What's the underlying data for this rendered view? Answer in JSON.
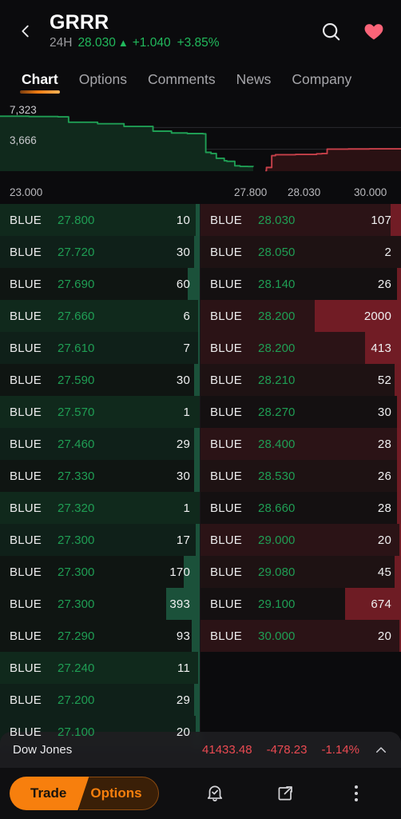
{
  "header": {
    "back_icon": "chevron-left-icon",
    "symbol": "GRRR",
    "period_label": "24H",
    "price": "28.030",
    "arrow": "▲",
    "change": "+1.040",
    "change_pct": "+3.85%",
    "search_icon": "search-icon",
    "favorite_icon": "heart-icon",
    "accent_up": "#21b95c",
    "accent_fav": "#fa6478"
  },
  "tabs": [
    {
      "label": "Chart",
      "active": true
    },
    {
      "label": "Options",
      "active": false
    },
    {
      "label": "Comments",
      "active": false
    },
    {
      "label": "News",
      "active": false
    },
    {
      "label": "Company",
      "active": false
    }
  ],
  "chart_data": {
    "type": "area",
    "title": "",
    "xlabel": "",
    "ylabel": "",
    "grid": true,
    "legend": "none",
    "y_ticks": [
      "7,323",
      "3,666"
    ],
    "x_ticks": [
      "23.000",
      "27.800",
      "28.030",
      "30.000"
    ],
    "ylim": [
      0,
      10989
    ],
    "xlim": [
      23.0,
      30.6
    ],
    "series": [
      {
        "name": "Bid depth",
        "color": "#1f9e54",
        "fill": "#10291c",
        "x": [
          23.0,
          23.55,
          24.1,
          24.3,
          24.85,
          25.35,
          25.9,
          26.25,
          26.55,
          26.85,
          26.9,
          27.0,
          27.1,
          27.25,
          27.3,
          27.45,
          27.55,
          27.7,
          27.8
        ],
        "y": [
          9200,
          9150,
          9100,
          8200,
          7950,
          7500,
          6700,
          6400,
          6300,
          6250,
          3150,
          2950,
          2150,
          1750,
          1650,
          900,
          800,
          780,
          760
        ]
      },
      {
        "name": "Ask depth",
        "color": "#c7404a",
        "fill": "#2a1113",
        "x": [
          28.03,
          28.05,
          28.15,
          28.22,
          28.6,
          29.0,
          29.1,
          29.2,
          29.6,
          30.0,
          30.6
        ],
        "y": [
          100,
          620,
          2600,
          2750,
          2800,
          2900,
          2950,
          3700,
          3720,
          3750,
          3780
        ]
      }
    ]
  },
  "book": {
    "bids": [
      {
        "mm": "BLUE",
        "price": "27.800",
        "size": "10",
        "bar_pct": 2,
        "shade": 2
      },
      {
        "mm": "BLUE",
        "price": "27.720",
        "size": "30",
        "bar_pct": 3,
        "shade": 1
      },
      {
        "mm": "BLUE",
        "price": "27.690",
        "size": "60",
        "bar_pct": 6,
        "shade": 0
      },
      {
        "mm": "BLUE",
        "price": "27.660",
        "size": "6",
        "bar_pct": 1,
        "shade": 2
      },
      {
        "mm": "BLUE",
        "price": "27.610",
        "size": "7",
        "bar_pct": 1,
        "shade": 1
      },
      {
        "mm": "BLUE",
        "price": "27.590",
        "size": "30",
        "bar_pct": 3,
        "shade": 0
      },
      {
        "mm": "BLUE",
        "price": "27.570",
        "size": "1",
        "bar_pct": 0,
        "shade": 2
      },
      {
        "mm": "BLUE",
        "price": "27.460",
        "size": "29",
        "bar_pct": 3,
        "shade": 1
      },
      {
        "mm": "BLUE",
        "price": "27.330",
        "size": "30",
        "bar_pct": 3,
        "shade": 0
      },
      {
        "mm": "BLUE",
        "price": "27.320",
        "size": "1",
        "bar_pct": 0,
        "shade": 2
      },
      {
        "mm": "BLUE",
        "price": "27.300",
        "size": "17",
        "bar_pct": 2,
        "shade": 1
      },
      {
        "mm": "BLUE",
        "price": "27.300",
        "size": "170",
        "bar_pct": 8,
        "shade": 0
      },
      {
        "mm": "BLUE",
        "price": "27.300",
        "size": "393",
        "bar_pct": 17,
        "shade": 0
      },
      {
        "mm": "BLUE",
        "price": "27.290",
        "size": "93",
        "bar_pct": 4,
        "shade": 0
      },
      {
        "mm": "BLUE",
        "price": "27.240",
        "size": "11",
        "bar_pct": 1,
        "shade": 2
      },
      {
        "mm": "BLUE",
        "price": "27.200",
        "size": "29",
        "bar_pct": 3,
        "shade": 1
      },
      {
        "mm": "BLUE",
        "price": "27.100",
        "size": "20",
        "bar_pct": 2,
        "shade": 1
      }
    ],
    "asks": [
      {
        "mm": "BLUE",
        "price": "28.030",
        "size": "107",
        "bar_pct": 5,
        "shade": 2
      },
      {
        "mm": "BLUE",
        "price": "28.050",
        "size": "2",
        "bar_pct": 0,
        "shade": 1
      },
      {
        "mm": "BLUE",
        "price": "28.140",
        "size": "26",
        "bar_pct": 2,
        "shade": 0
      },
      {
        "mm": "BLUE",
        "price": "28.200",
        "size": "2000",
        "bar_pct": 43,
        "shade": 2
      },
      {
        "mm": "BLUE",
        "price": "28.200",
        "size": "413",
        "bar_pct": 18,
        "shade": 2
      },
      {
        "mm": "BLUE",
        "price": "28.210",
        "size": "52",
        "bar_pct": 3,
        "shade": 1
      },
      {
        "mm": "BLUE",
        "price": "28.270",
        "size": "30",
        "bar_pct": 2,
        "shade": 0
      },
      {
        "mm": "BLUE",
        "price": "28.400",
        "size": "28",
        "bar_pct": 2,
        "shade": 2
      },
      {
        "mm": "BLUE",
        "price": "28.530",
        "size": "26",
        "bar_pct": 2,
        "shade": 1
      },
      {
        "mm": "BLUE",
        "price": "28.660",
        "size": "28",
        "bar_pct": 2,
        "shade": 0
      },
      {
        "mm": "BLUE",
        "price": "29.000",
        "size": "20",
        "bar_pct": 1,
        "shade": 2
      },
      {
        "mm": "BLUE",
        "price": "29.080",
        "size": "45",
        "bar_pct": 3,
        "shade": 1
      },
      {
        "mm": "BLUE",
        "price": "29.100",
        "size": "674",
        "bar_pct": 28,
        "shade": 0
      },
      {
        "mm": "BLUE",
        "price": "30.000",
        "size": "20",
        "bar_pct": 1,
        "shade": 2
      }
    ]
  },
  "ticker": {
    "name": "Dow Jones",
    "value": "41433.48",
    "change": "-478.23",
    "change_pct": "-1.14%",
    "expand_icon": "chevron-up-icon",
    "down_color": "#ea4a52"
  },
  "bottom": {
    "trade_label": "Trade",
    "options_label": "Options",
    "alert_icon": "bell-check-icon",
    "share_icon": "share-icon",
    "more_icon": "more-vertical-icon",
    "accent": "#f77f0d"
  }
}
